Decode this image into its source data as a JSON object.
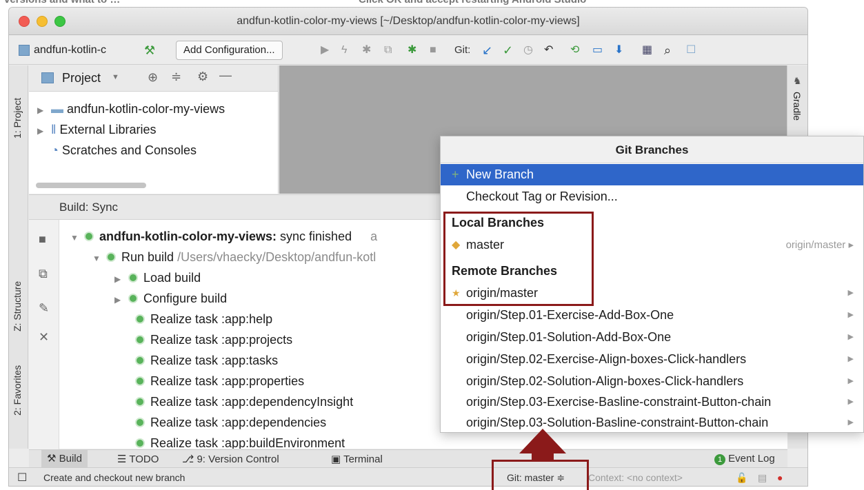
{
  "bleed": {
    "left": "versions and what to …",
    "right": "Click OK and accept restarting Android Studio"
  },
  "window": {
    "title": "andfun-kotlin-color-my-views [~/Desktop/andfun-kotlin-color-my-views]"
  },
  "toolbar": {
    "project_chip": "andfun-kotlin-c",
    "add_config": "Add Configuration...",
    "git_label": "Git:"
  },
  "left_strip": {
    "project": "1: Project",
    "structure": "Z: Structure",
    "favorites": "2: Favorites"
  },
  "right_strip": {
    "gradle": "Gradle"
  },
  "project_panel": {
    "header": "Project",
    "rows": [
      "andfun-kotlin-color-my-views",
      "External Libraries",
      "Scratches and Consoles"
    ]
  },
  "build": {
    "tab": "Build: Sync",
    "root_bold": "andfun-kotlin-color-my-views:",
    "root_rest": "sync finished",
    "root_tail": "a",
    "run_label": "Run build",
    "run_path": "/Users/vhaecky/Desktop/andfun-kotl",
    "rows": [
      "Load build",
      "Configure build",
      "Realize task :app:help",
      "Realize task :app:projects",
      "Realize task :app:tasks",
      "Realize task :app:properties",
      "Realize task :app:dependencyInsight",
      "Realize task :app:dependencies",
      "Realize task :app:buildEnvironment"
    ]
  },
  "bottombar": {
    "build": "Build",
    "todo": "TODO",
    "vcs": "9: Version Control",
    "terminal": "Terminal",
    "event_log": "Event Log",
    "event_count": "1"
  },
  "status": {
    "message": "Create and checkout new branch",
    "git": "Git: master ≑",
    "context": "Context: <no context>"
  },
  "popup": {
    "title": "Git Branches",
    "new_branch": "New Branch",
    "checkout_tag": "Checkout Tag or Revision...",
    "local_header": "Local Branches",
    "local_branch": "master",
    "local_tracking": "origin/master",
    "remote_header": "Remote Branches",
    "remote_branches": [
      "origin/master",
      "origin/Step.01-Exercise-Add-Box-One",
      "origin/Step.01-Solution-Add-Box-One",
      "origin/Step.02-Exercise-Align-boxes-Click-handlers",
      "origin/Step.02-Solution-Align-boxes-Click-handlers",
      "origin/Step.03-Exercise-Basline-constraint-Button-chain",
      "origin/Step.03-Solution-Basline-constraint-Button-chain"
    ]
  },
  "colors": {
    "accent_selection": "#2f66c9",
    "annotation": "#8b1a1a",
    "ok_green": "#59b35b"
  }
}
